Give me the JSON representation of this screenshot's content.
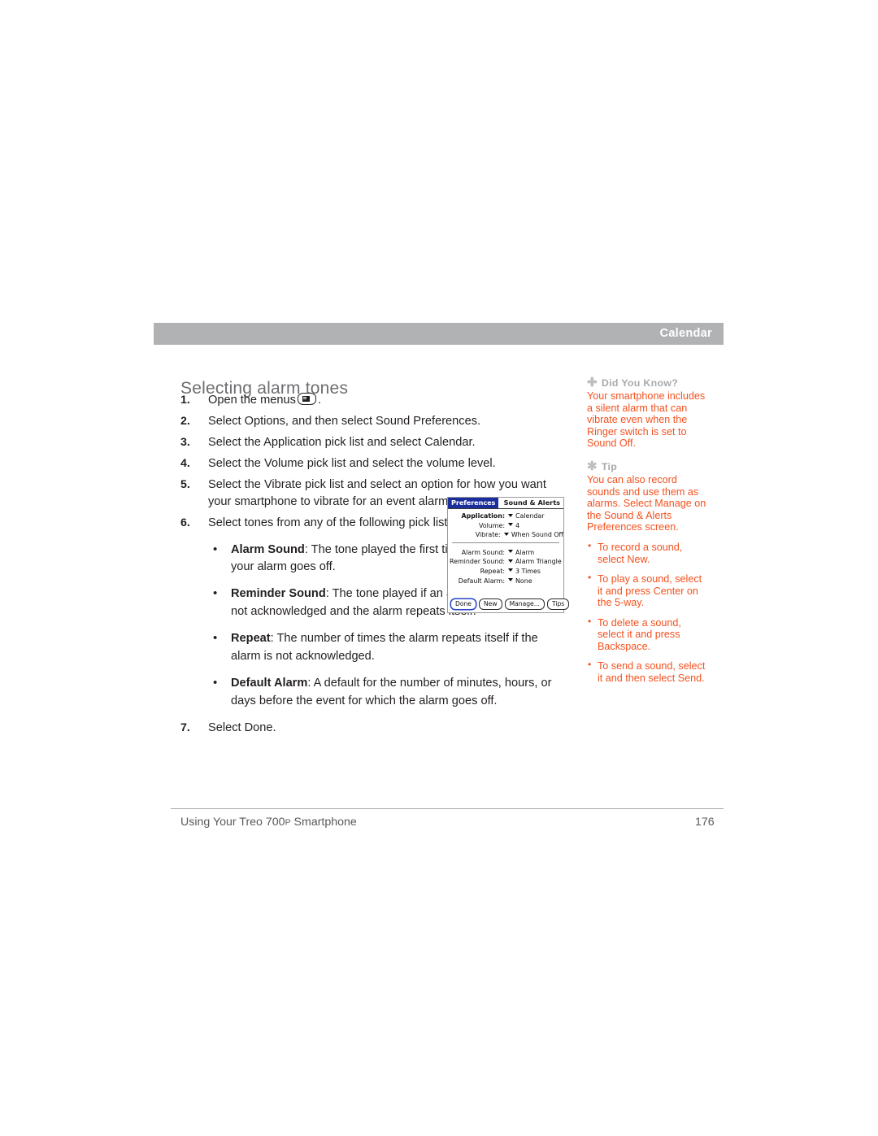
{
  "header": {
    "chapter": "Calendar"
  },
  "page_title": "Selecting alarm tones",
  "steps": [
    {
      "num": "1.",
      "text_before": "Open the menus",
      "has_menu_icon": true,
      "text_after": "."
    },
    {
      "num": "2.",
      "text": "Select Options, and then select Sound Preferences."
    },
    {
      "num": "3.",
      "text": "Select the Application pick list and select Calendar."
    },
    {
      "num": "4.",
      "text": "Select the Volume pick list and select the volume level."
    },
    {
      "num": "5.",
      "text": "Select the Vibrate pick list and select an option for how you want your smartphone to vibrate for an event alarm."
    },
    {
      "num": "6.",
      "text": "Select tones from any of the following pick lists:"
    },
    {
      "num": "7.",
      "text": "Select Done."
    }
  ],
  "sublist": [
    {
      "term": "Alarm Sound",
      "desc": ": The tone played the first time your alarm goes off."
    },
    {
      "term": "Reminder Sound",
      "desc": ": The tone played if an alarm is not acknowledged and the alarm repeats itself."
    },
    {
      "term": "Repeat",
      "desc": ": The number of times the alarm repeats itself if the alarm is not acknowledged."
    },
    {
      "term": "Default Alarm",
      "desc": ": A default for the number of minutes, hours, or days before the event for which the alarm goes off."
    }
  ],
  "pda": {
    "app_title": "Preferences",
    "screen_title": "Sound & Alerts",
    "rows_top": [
      {
        "label": "Application:",
        "value": "Calendar",
        "strong": true
      },
      {
        "label": "Volume:",
        "value": "4",
        "strong": false
      },
      {
        "label": "Vibrate:",
        "value": "When Sound Off",
        "strong": false
      }
    ],
    "rows_bottom": [
      {
        "label": "Alarm Sound:",
        "value": "Alarm"
      },
      {
        "label": "Reminder Sound:",
        "value": "Alarm Triangle"
      },
      {
        "label": "Repeat:",
        "value": "3 Times"
      },
      {
        "label": "Default Alarm:",
        "value": "None"
      }
    ],
    "buttons": [
      {
        "label": "Done",
        "focused": true
      },
      {
        "label": "New",
        "focused": false
      },
      {
        "label": "Manage...",
        "focused": false
      },
      {
        "label": "Tips",
        "focused": false
      }
    ]
  },
  "sidebar": {
    "did_you_know": {
      "icon": "plus-icon",
      "icon_glyph": "✚",
      "heading": "Did You Know?",
      "body": "Your smartphone includes a silent alarm that can vibrate even when the Ringer switch is set to Sound Off."
    },
    "tip": {
      "icon": "asterisk-icon",
      "icon_glyph": "✱",
      "heading": "Tip",
      "body": "You can also record sounds and use them as alarms. Select Manage on the Sound & Alerts Preferences screen.",
      "bullets": [
        "To record a sound, select New.",
        "To play a sound, select it and press Center on the 5-way.",
        "To delete a sound, select it and press Backspace.",
        "To send a sound, select it and then select Send."
      ]
    }
  },
  "footer": {
    "book_title_part1": "Using Your Treo 700",
    "book_title_smallcap": "P",
    "book_title_part2": " Smartphone",
    "page_number": "176"
  },
  "colors": {
    "header_bar": "#b0b2b4",
    "accent_orange": "#f4511e",
    "sidebar_heading_gray": "#a7a9ac",
    "title_gray": "#6d6e71",
    "pda_title_blue": "#1b2f9c"
  }
}
